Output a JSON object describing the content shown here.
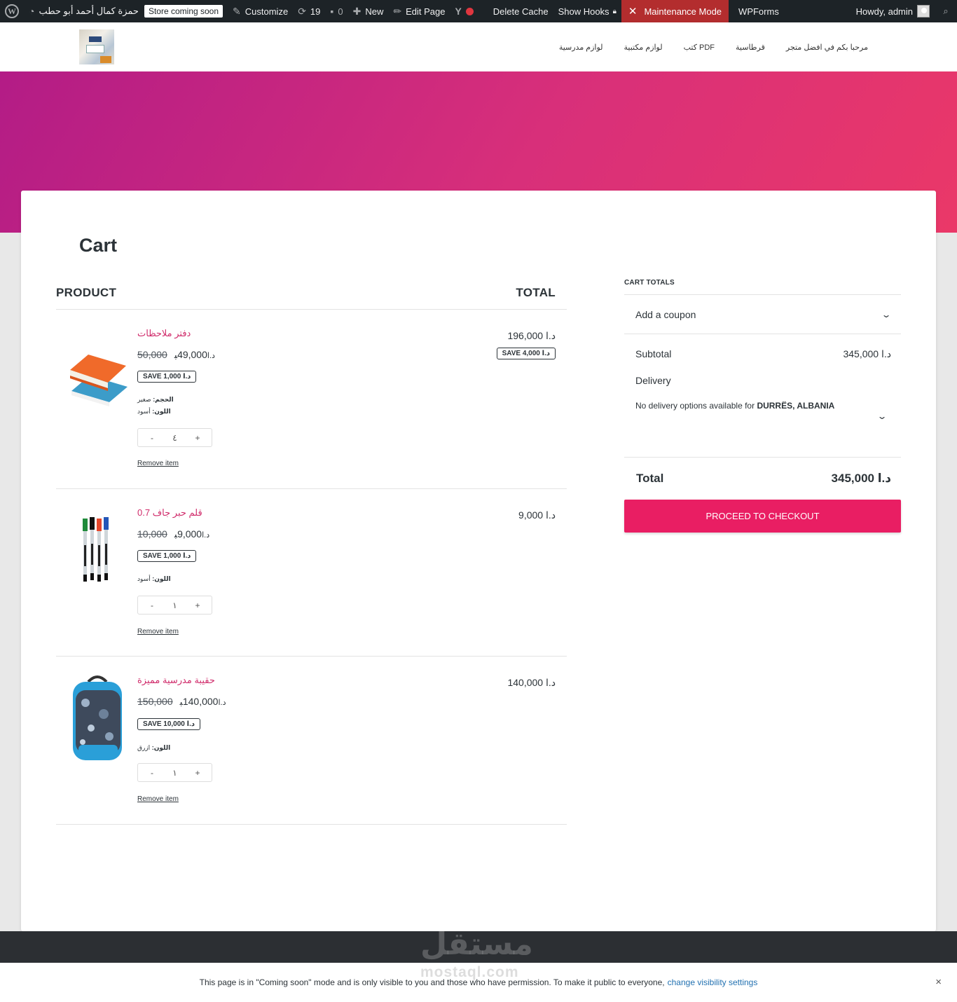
{
  "adminbar": {
    "site_name": "حمزة كمال أحمد أبو حطب",
    "store_badge": "Store coming soon",
    "customize": "Customize",
    "updates_count": "19",
    "comments_count": "0",
    "new": "New",
    "edit_page": "Edit Page",
    "yoast_icon": "Y",
    "delete_cache": "Delete Cache",
    "show_hooks": "Show Hooks",
    "maintenance": "Maintenance Mode",
    "wpforms": "WPForms",
    "howdy": "Howdy, admin"
  },
  "nav": {
    "items": [
      "مرحبا بكم في افضل متجر",
      "قرطاسية",
      "كتب PDF",
      "لوازم مكتبية",
      "لوازم مدرسية"
    ]
  },
  "cart": {
    "title": "Cart",
    "col_product": "PRODUCT",
    "col_total": "TOTAL",
    "items": [
      {
        "name": "دفتر ملاحظات",
        "old_price": "50,000",
        "currency": "د.ا",
        "price": "49,000",
        "price_suffix": "ﺒ",
        "save": "SAVE 1,000 د.ا",
        "meta": [
          {
            "label": "الحجم:",
            "value": "صغير"
          },
          {
            "label": "اللون:",
            "value": "أسود"
          }
        ],
        "qty": "٤",
        "remove": "Remove item",
        "total": "196,000 د.ا",
        "total_save": "SAVE 4,000 د.ا"
      },
      {
        "name": "قلم حبر جاف 0.7",
        "old_price": "10,000",
        "currency": "د.ا",
        "price": "9,000",
        "price_suffix": "ﺒ",
        "save": "SAVE 1,000 د.ا",
        "meta": [
          {
            "label": "اللون:",
            "value": "أسود"
          }
        ],
        "qty": "١",
        "remove": "Remove item",
        "total": "9,000 د.ا"
      },
      {
        "name": "حقيبة مدرسية مميزة",
        "old_price": "150,000",
        "currency": "د.ا",
        "price": "140,000",
        "price_suffix": "ﺒ",
        "save": "SAVE 10,000 د.ا",
        "meta": [
          {
            "label": "اللون:",
            "value": "ازرق"
          }
        ],
        "qty": "١",
        "remove": "Remove item",
        "total": "140,000 د.ا"
      }
    ]
  },
  "totals": {
    "title": "CART TOTALS",
    "coupon": "Add a coupon",
    "subtotal_label": "Subtotal",
    "subtotal_value": "345,000 د.ا",
    "delivery_label": "Delivery",
    "delivery_note": "No delivery options available for",
    "delivery_location": "DURRËS, ALBANIA",
    "total_label": "Total",
    "total_value": "345,000 د.ا",
    "checkout": "PROCEED TO CHECKOUT"
  },
  "watermark": {
    "arabic": "مستقل",
    "latin": "mostaql.com"
  },
  "notice": {
    "text": "This page is in \"Coming soon\" mode and is only visible to you and those who have permission. To make it public to everyone,",
    "link": "change visibility settings",
    "close": "×"
  },
  "colors": {
    "accent": "#e91e63",
    "product_link": "#d02c6b",
    "hero_start": "#b31c86",
    "hero_end": "#ea3868",
    "adminbar": "#1d2327",
    "maintenance": "#b32d2e"
  }
}
